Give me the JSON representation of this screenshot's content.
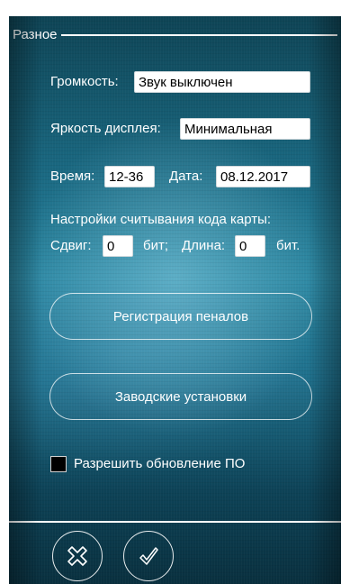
{
  "section": {
    "title": "Разное"
  },
  "volume": {
    "label": "Громкость:",
    "value": "Звук выключен"
  },
  "brightness": {
    "label": "Яркость дисплея:",
    "value": "Минимальная"
  },
  "time": {
    "label": "Время:",
    "value": "12-36"
  },
  "date": {
    "label": "Дата:",
    "value": "08.12.2017"
  },
  "card_reading": {
    "title": "Настройки считывания кода карты:",
    "offset_label": "Сдвиг:",
    "offset_value": "0",
    "offset_unit": "бит;",
    "length_label": "Длина:",
    "length_value": "0",
    "length_unit": "бит."
  },
  "buttons": {
    "register_cases": "Регистрация пеналов",
    "factory_settings": "Заводские установки"
  },
  "firmware_update": {
    "label": "Разрешить обновление ПО",
    "checked": true
  },
  "footer": {
    "cancel_icon": "cross-icon",
    "ok_icon": "check-icon"
  },
  "colors": {
    "accent": "#1a6982",
    "field_bg": "#ffffff",
    "text": "#ffffff"
  }
}
